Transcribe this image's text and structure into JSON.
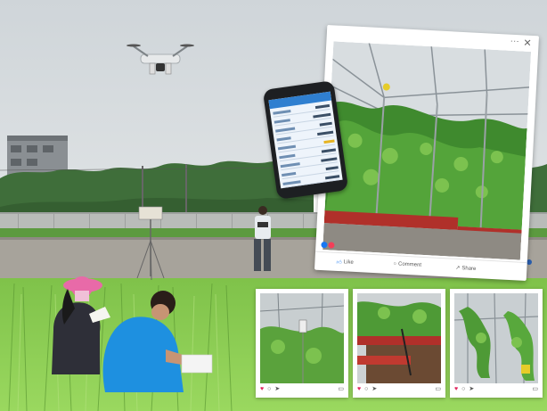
{
  "colors": {
    "sky": "#d3d8dc",
    "trees": "#3f6e3a",
    "rice": "#8fcf56",
    "shirt_blue": "#1e90e0",
    "hat_pink": "#e86aa8",
    "facebook_blue": "#1877f2",
    "heart_red": "#e0245e"
  },
  "scene": {
    "objects": [
      "drone",
      "weather-station-mast",
      "operator-with-remote",
      "researcher-pink-hat",
      "researcher-blue-shirt",
      "building",
      "tree-line",
      "rice-paddy"
    ]
  },
  "social_post": {
    "window_controls": {
      "more_icon": "more-icon",
      "close_icon": "close-icon",
      "more_glyph": "···",
      "close_glyph": "✕"
    },
    "actions": [
      {
        "icon": "like-icon",
        "label": "Like"
      },
      {
        "icon": "comment-icon",
        "label": "Comment"
      },
      {
        "icon": "share-icon",
        "label": "Share"
      }
    ]
  },
  "instagram_cards": [
    {
      "scene": "greenhouse-sensor-plants",
      "icons": [
        "heart-icon",
        "comment-icon",
        "send-icon",
        "bookmark-icon"
      ]
    },
    {
      "scene": "greenhouse-planters-soil",
      "icons": [
        "heart-icon",
        "comment-icon",
        "send-icon",
        "bookmark-icon"
      ]
    },
    {
      "scene": "greenhouse-vines-trellis",
      "icons": [
        "heart-icon",
        "comment-icon",
        "send-icon",
        "bookmark-icon"
      ]
    }
  ],
  "glyphs": {
    "heart": "♥",
    "comment": "○",
    "send": "➤",
    "bookmark": "▭",
    "like": "👍︎",
    "share": "↗"
  }
}
